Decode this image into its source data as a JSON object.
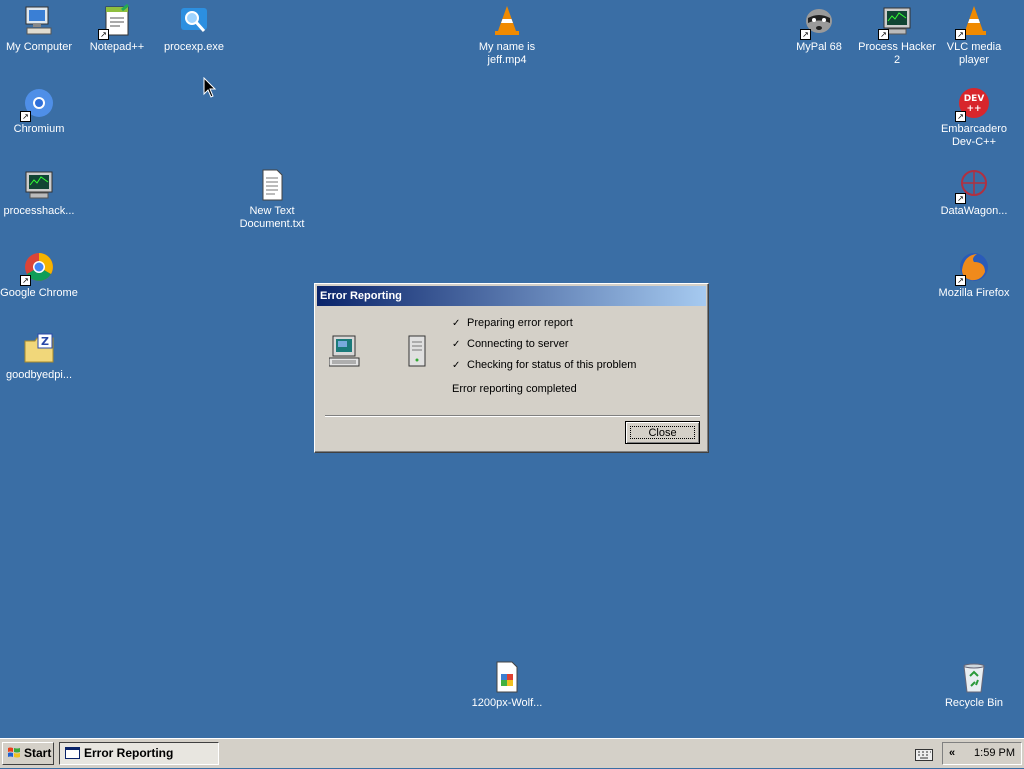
{
  "desktop_icons": {
    "my_computer": "My Computer",
    "notepadpp": "Notepad++",
    "procexp": "procexp.exe",
    "video": "My name is jeff.mp4",
    "mypal": "MyPal 68",
    "process_hacker": "Process Hacker 2",
    "vlc": "VLC media player",
    "chromium": "Chromium",
    "devcpp": "Embarcadero Dev-C++",
    "processhack": "processhack...",
    "new_text": "New Text Document.txt",
    "datawagon": "DataWagon...",
    "chrome": "Google Chrome",
    "firefox": "Mozilla Firefox",
    "goodbyedpi": "goodbyedpi...",
    "wolf_image": "1200px-Wolf...",
    "recycle_bin": "Recycle Bin"
  },
  "dialog": {
    "title": "Error Reporting",
    "steps": [
      "Preparing error report",
      "Connecting to server",
      "Checking for status of this problem"
    ],
    "check_glyph": "✓",
    "status": "Error reporting completed",
    "close_label": "Close"
  },
  "taskbar": {
    "start_label": "Start",
    "task_label": "Error Reporting",
    "tray_chevron": "«",
    "clock": "1:59 PM"
  },
  "colors": {
    "desktop": "#3a6ea5",
    "titlebar_start": "#0a246a",
    "titlebar_end": "#a6caf0",
    "face": "#d4d0c8"
  }
}
